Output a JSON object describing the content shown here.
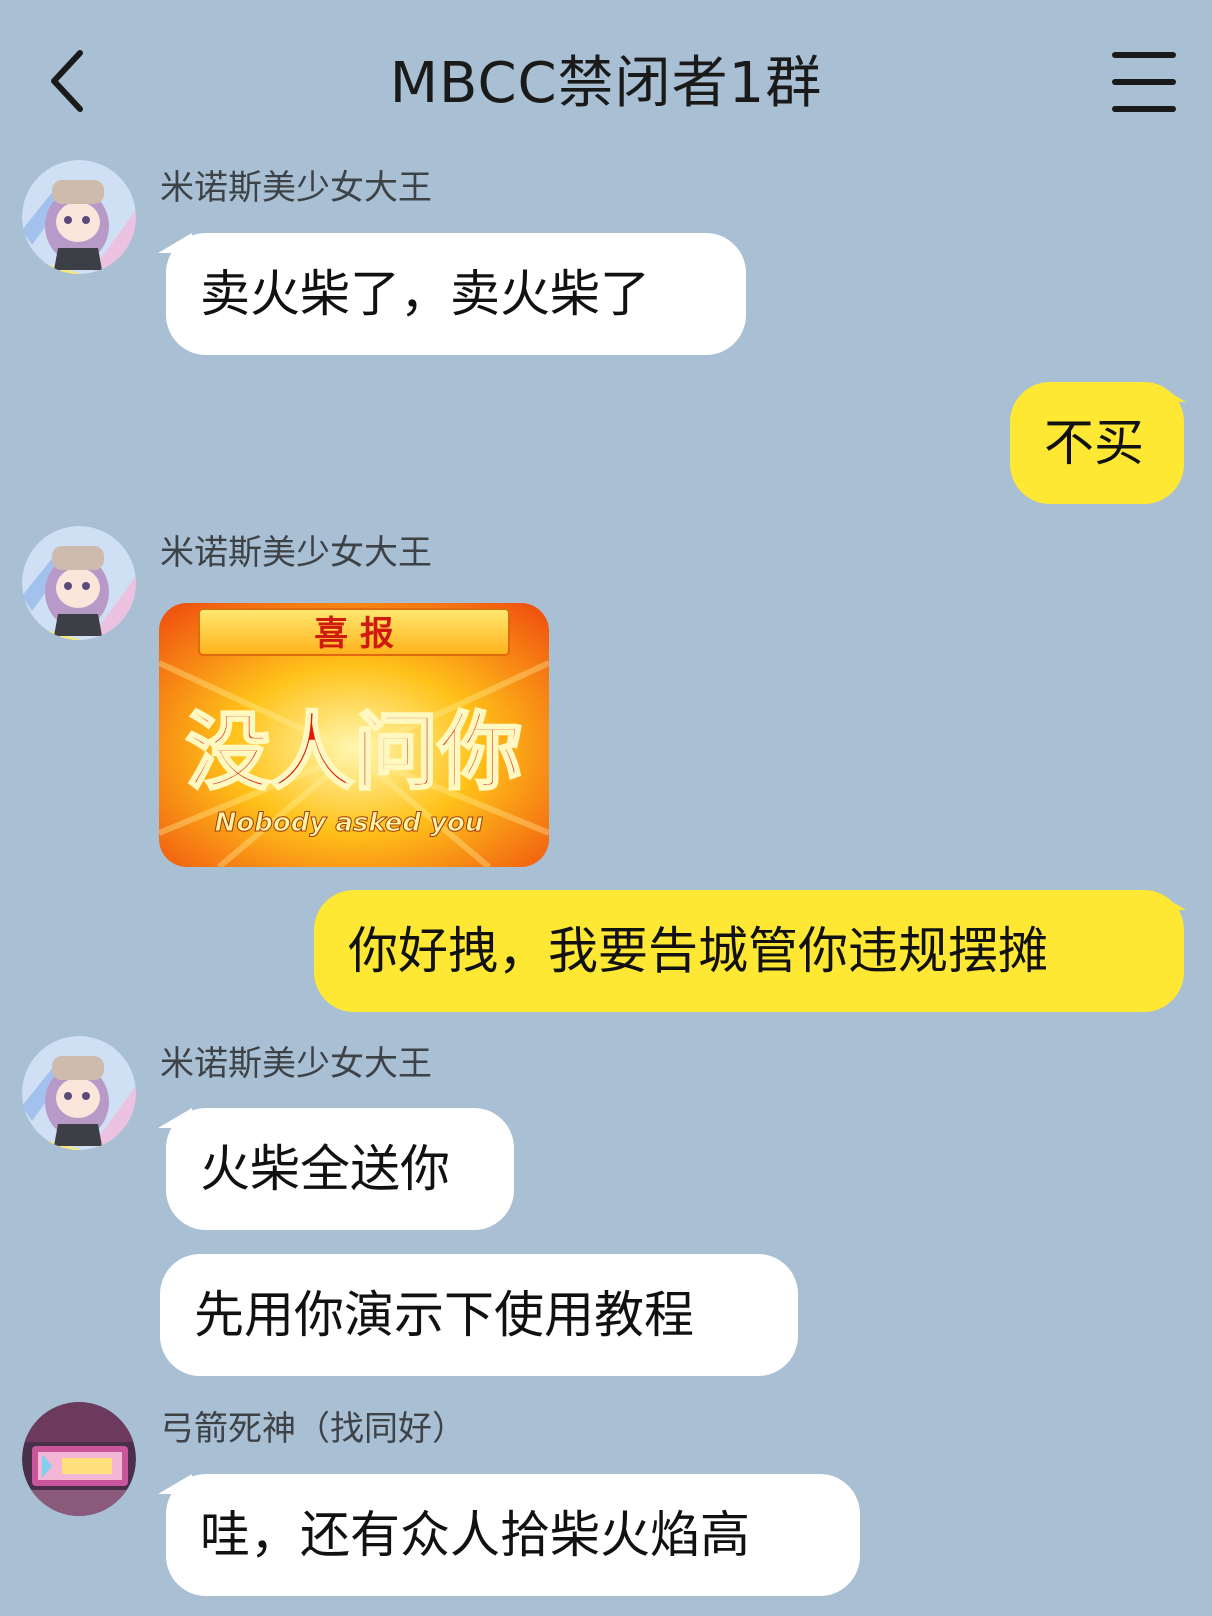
{
  "header": {
    "title": "MBCC禁闭者1群",
    "back_icon": "chevron-left-icon",
    "menu_icon": "hamburger-menu-icon"
  },
  "colors": {
    "background": "#a9bfd3",
    "incoming_bubble": "#ffffff",
    "outgoing_bubble": "#ffe834"
  },
  "messages": [
    {
      "sender": "米诺斯美少女大王",
      "text": "卖火柴了，卖火柴了",
      "direction": "incoming"
    },
    {
      "text": "不买",
      "direction": "outgoing"
    },
    {
      "sender": "米诺斯美少女大王",
      "type": "sticker",
      "direction": "incoming",
      "sticker": {
        "top_text": "喜 报",
        "main_text": "没人问你",
        "sub_text": "Nobody asked you"
      }
    },
    {
      "text": "你好拽，我要告城管你违规摆摊",
      "direction": "outgoing"
    },
    {
      "sender": "米诺斯美少女大王",
      "text": "火柴全送你",
      "direction": "incoming"
    },
    {
      "text": "先用你演示下使用教程",
      "direction": "incoming"
    },
    {
      "sender": "弓箭死神（找同好）",
      "text": "哇，还有众人拾柴火焰高",
      "direction": "incoming"
    }
  ]
}
